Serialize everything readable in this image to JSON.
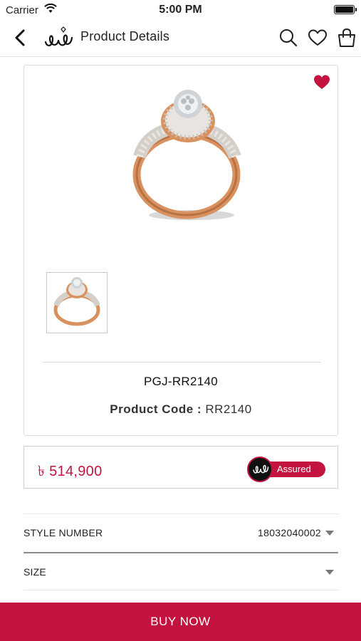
{
  "status_bar": {
    "carrier": "Carrier",
    "time": "5:00 PM"
  },
  "navbar": {
    "title": "Product Details",
    "icons": [
      "back-arrow-icon",
      "brand-logo",
      "search-icon",
      "heart-icon",
      "shopping-bag-icon"
    ]
  },
  "product": {
    "name": "PGJ-RR2140",
    "code_label": "Product Code :",
    "code": "RR2140",
    "favorite": true,
    "image": "rose-gold-diamond-ring"
  },
  "price": {
    "amount": "৳ 514,900",
    "badge": "Assured"
  },
  "options": {
    "style_label": "STYLE NUMBER",
    "style_value": "18032040002",
    "size_label": "SIZE",
    "size_value": ""
  },
  "buy_button": "BUY NOW",
  "colors": {
    "accent": "#c2143f",
    "gold": "#d9925f",
    "border": "#dcdcdc"
  }
}
